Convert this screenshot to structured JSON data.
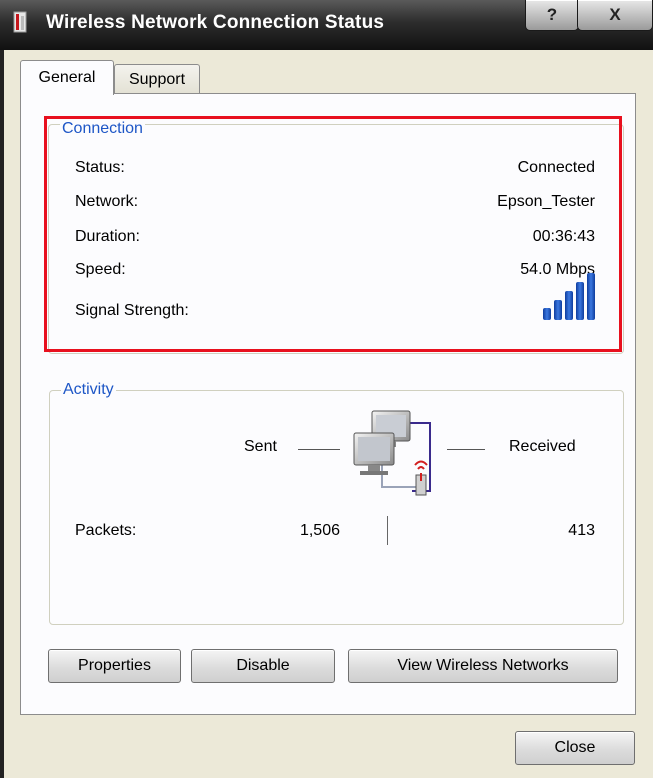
{
  "window": {
    "title": "Wireless Network Connection Status",
    "help_label": "?",
    "close_glyph": "X"
  },
  "tabs": [
    {
      "label": "General",
      "selected": true
    },
    {
      "label": "Support",
      "selected": false
    }
  ],
  "connection": {
    "legend": "Connection",
    "rows": [
      {
        "label": "Status:",
        "value": "Connected"
      },
      {
        "label": "Network:",
        "value": "Epson_Tester"
      },
      {
        "label": "Duration:",
        "value": "00:36:43"
      },
      {
        "label": "Speed:",
        "value": "54.0 Mbps"
      }
    ],
    "signal_label": "Signal Strength:",
    "signal_bars": 5
  },
  "activity": {
    "legend": "Activity",
    "sent_label": "Sent",
    "received_label": "Received",
    "packets_label": "Packets:",
    "packets_sent": "1,506",
    "packets_received": "413"
  },
  "buttons": {
    "properties": "Properties",
    "disable": "Disable",
    "view_wireless": "View Wireless Networks",
    "close": "Close"
  },
  "colors": {
    "legend_blue": "#1d56c6",
    "highlight_red": "#e8101e",
    "signal_blue": "#1f55c8"
  }
}
